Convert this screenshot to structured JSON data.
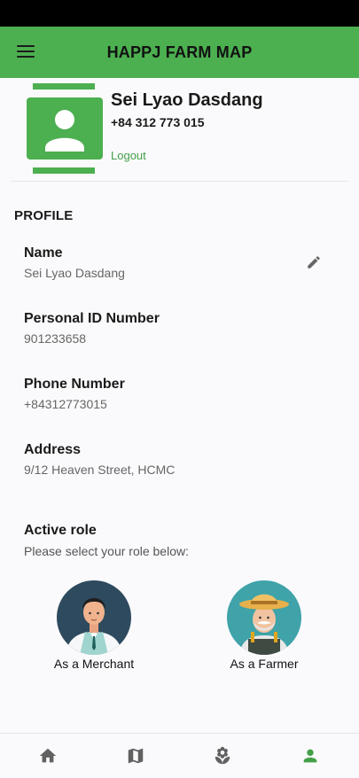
{
  "app": {
    "title": "HAPPJ FARM MAP"
  },
  "user": {
    "name": "Sei Lyao Dasdang",
    "phone": "+84 312 773 015",
    "logout_label": "Logout"
  },
  "profile": {
    "section_title": "PROFILE",
    "fields": [
      {
        "label": "Name",
        "value": "Sei Lyao Dasdang"
      },
      {
        "label": "Personal ID Number",
        "value": "901233658"
      },
      {
        "label": "Phone Number",
        "value": "+84312773015"
      },
      {
        "label": "Address",
        "value": "9/12 Heaven Street, HCMC"
      }
    ]
  },
  "roles": {
    "title": "Active role",
    "subtitle": "Please select your role below:",
    "options": [
      {
        "label": "As a Merchant",
        "icon": "merchant-avatar"
      },
      {
        "label": "As a Farmer",
        "icon": "farmer-avatar"
      }
    ]
  },
  "bottom_nav": {
    "items": [
      {
        "icon": "home-icon"
      },
      {
        "icon": "map-icon"
      },
      {
        "icon": "flower-icon"
      },
      {
        "icon": "person-icon",
        "active": true
      }
    ]
  },
  "colors": {
    "primary": "#4caf50",
    "link": "#43a047",
    "active_nav": "#43a047",
    "inactive_nav": "#616161"
  }
}
